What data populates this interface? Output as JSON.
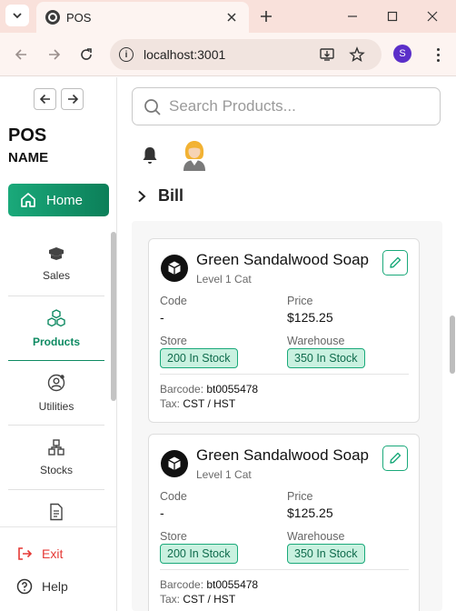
{
  "browser": {
    "tab_title": "POS",
    "url": "localhost:3001",
    "profile_initial": "S"
  },
  "sidebar": {
    "brand_title": "POS",
    "brand_subtitle": "NAME",
    "home_label": "Home",
    "items": [
      {
        "label": "Sales",
        "icon": "box-icon"
      },
      {
        "label": "Products",
        "icon": "cubes-icon",
        "active": true
      },
      {
        "label": "Utilities",
        "icon": "user-gear-icon"
      },
      {
        "label": "Stocks",
        "icon": "boxes-icon"
      },
      {
        "label": "",
        "icon": "document-icon"
      }
    ],
    "exit_label": "Exit",
    "help_label": "Help"
  },
  "main": {
    "search_placeholder": "Search Products...",
    "bill_title": "Bill",
    "products": [
      {
        "name": "Green Sandalwood Soap",
        "category": "Level 1 Cat",
        "code_label": "Code",
        "code_value": "-",
        "price_label": "Price",
        "price_value": "$125.25",
        "store_label": "Store",
        "store_stock": "200 In Stock",
        "warehouse_label": "Warehouse",
        "warehouse_stock": "350 In Stock",
        "barcode_label": "Barcode:",
        "barcode_value": "bt0055478",
        "tax_label": "Tax:",
        "tax_value": "CST / HST"
      },
      {
        "name": "Green Sandalwood Soap",
        "category": "Level 1 Cat",
        "code_label": "Code",
        "code_value": "-",
        "price_label": "Price",
        "price_value": "$125.25",
        "store_label": "Store",
        "store_stock": "200 In Stock",
        "warehouse_label": "Warehouse",
        "warehouse_stock": "350 In Stock",
        "barcode_label": "Barcode:",
        "barcode_value": "bt0055478",
        "tax_label": "Tax:",
        "tax_value": "CST / HST"
      }
    ]
  },
  "colors": {
    "accent": "#0e8a62",
    "exit": "#e53935",
    "badge_bg": "#c9f1e0"
  }
}
